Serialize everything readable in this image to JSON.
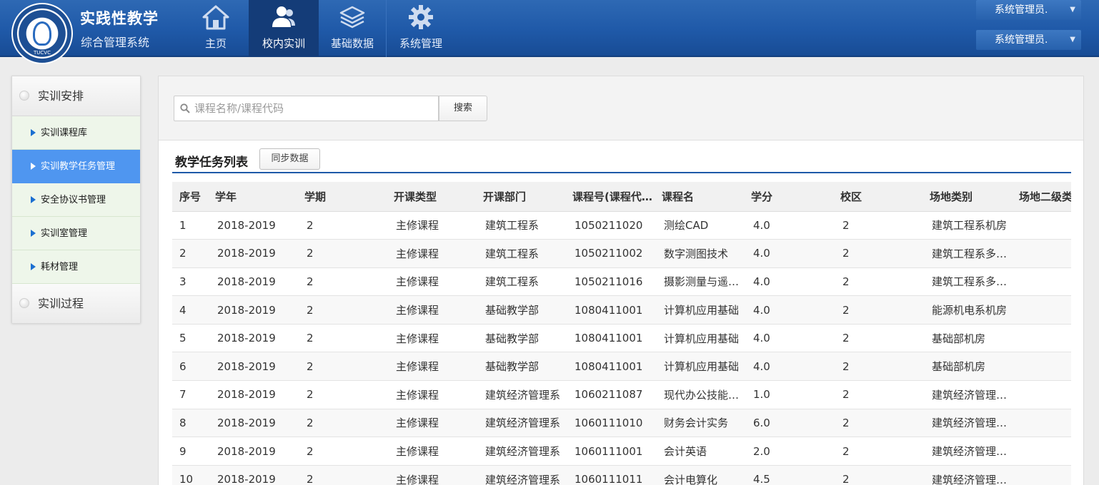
{
  "brand": {
    "title": "实践性教学",
    "subtitle": "综合管理系统",
    "logo_text": "TUCVC"
  },
  "nav": {
    "items": [
      {
        "label": "主页",
        "icon": "home-icon"
      },
      {
        "label": "校内实训",
        "icon": "users-icon"
      },
      {
        "label": "基础数据",
        "icon": "layers-icon"
      },
      {
        "label": "系统管理",
        "icon": "gear-icon"
      }
    ],
    "active": "校内实训"
  },
  "user": {
    "name1": "系统管理员.",
    "name2": "系统管理员."
  },
  "sidebar": {
    "group1": "实训安排",
    "items": [
      {
        "label": "实训课程库"
      },
      {
        "label": "实训教学任务管理"
      },
      {
        "label": "安全协议书管理"
      },
      {
        "label": "实训室管理"
      },
      {
        "label": "耗材管理"
      }
    ],
    "active": "实训教学任务管理",
    "group2": "实训过程"
  },
  "search": {
    "placeholder": "课程名称/课程代码",
    "value": "",
    "button_label": "搜索"
  },
  "list": {
    "title": "教学任务列表",
    "sync_label": "同步数据"
  },
  "table": {
    "columns": [
      "序号",
      "学年",
      "学期",
      "开课类型",
      "开课部门",
      "课程号(课程代码)",
      "课程名",
      "学分",
      "校区",
      "场地类别",
      "场地二级类别"
    ],
    "rows": [
      [
        "1",
        "2018-2019",
        "2",
        "主修课程",
        "建筑工程系",
        "1050211020",
        "测绘CAD",
        "4.0",
        "2",
        "建筑工程系机房",
        ""
      ],
      [
        "2",
        "2018-2019",
        "2",
        "主修课程",
        "建筑工程系",
        "1050211002",
        "数字测图技术",
        "4.0",
        "2",
        "建筑工程系多媒体教室",
        ""
      ],
      [
        "3",
        "2018-2019",
        "2",
        "主修课程",
        "建筑工程系",
        "1050211016",
        "摄影测量与遥感技术",
        "4.0",
        "2",
        "建筑工程系多媒体教室",
        ""
      ],
      [
        "4",
        "2018-2019",
        "2",
        "主修课程",
        "基础教学部",
        "1080411001",
        "计算机应用基础",
        "4.0",
        "2",
        "能源机电系机房",
        ""
      ],
      [
        "5",
        "2018-2019",
        "2",
        "主修课程",
        "基础教学部",
        "1080411001",
        "计算机应用基础",
        "4.0",
        "2",
        "基础部机房",
        ""
      ],
      [
        "6",
        "2018-2019",
        "2",
        "主修课程",
        "基础教学部",
        "1080411001",
        "计算机应用基础",
        "4.0",
        "2",
        "基础部机房",
        ""
      ],
      [
        "7",
        "2018-2019",
        "2",
        "主修课程",
        "建筑经济管理系",
        "1060211087",
        "现代办公技能训练",
        "1.0",
        "2",
        "建筑经济管理系机房",
        ""
      ],
      [
        "8",
        "2018-2019",
        "2",
        "主修课程",
        "建筑经济管理系",
        "1060111010",
        "财务会计实务",
        "6.0",
        "2",
        "建筑经济管理系机房",
        ""
      ],
      [
        "9",
        "2018-2019",
        "2",
        "主修课程",
        "建筑经济管理系",
        "1060111001",
        "会计英语",
        "2.0",
        "2",
        "建筑经济管理系机房",
        ""
      ],
      [
        "10",
        "2018-2019",
        "2",
        "主修课程",
        "建筑经济管理系",
        "1060111011",
        "会计电算化",
        "4.5",
        "2",
        "建筑经济管理系机房",
        ""
      ]
    ]
  },
  "colors": {
    "header": "#1f59a8",
    "nav_active": "#143c78",
    "sidebar_active": "#4f96f0",
    "title_rule": "#1e5aa8"
  }
}
